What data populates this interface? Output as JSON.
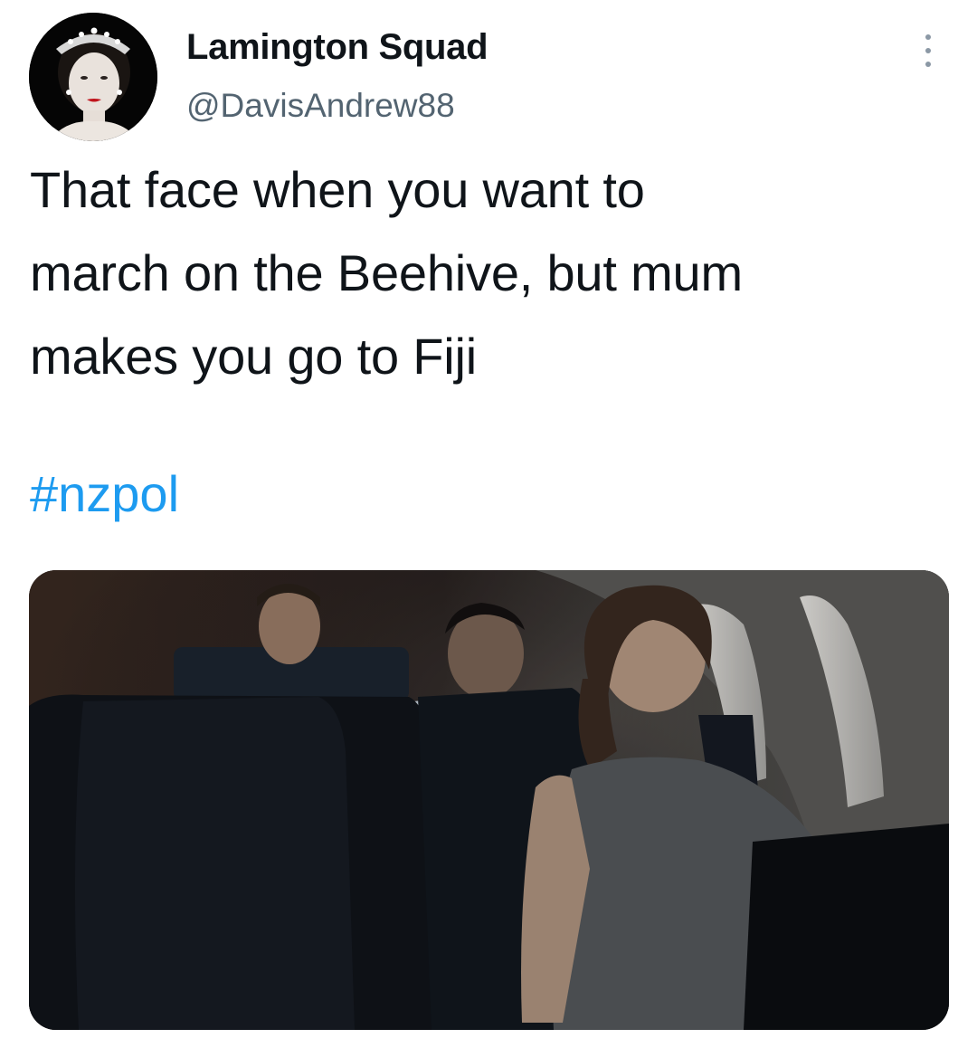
{
  "tweet": {
    "author": {
      "display_name": "Lamington Squad",
      "handle": "@DavisAndrew88",
      "avatar_icon": "avatar-portrait"
    },
    "more_icon": "more-options-icon",
    "text_lines": [
      "That face when you want to",
      "march on the Beehive, but mum",
      "makes you go to Fiji"
    ],
    "hashtag": "#nzpol",
    "media": {
      "type": "photo"
    }
  },
  "colors": {
    "text": "#0f1419",
    "secondary": "#536471",
    "link": "#1d9bf0",
    "background": "#ffffff"
  }
}
